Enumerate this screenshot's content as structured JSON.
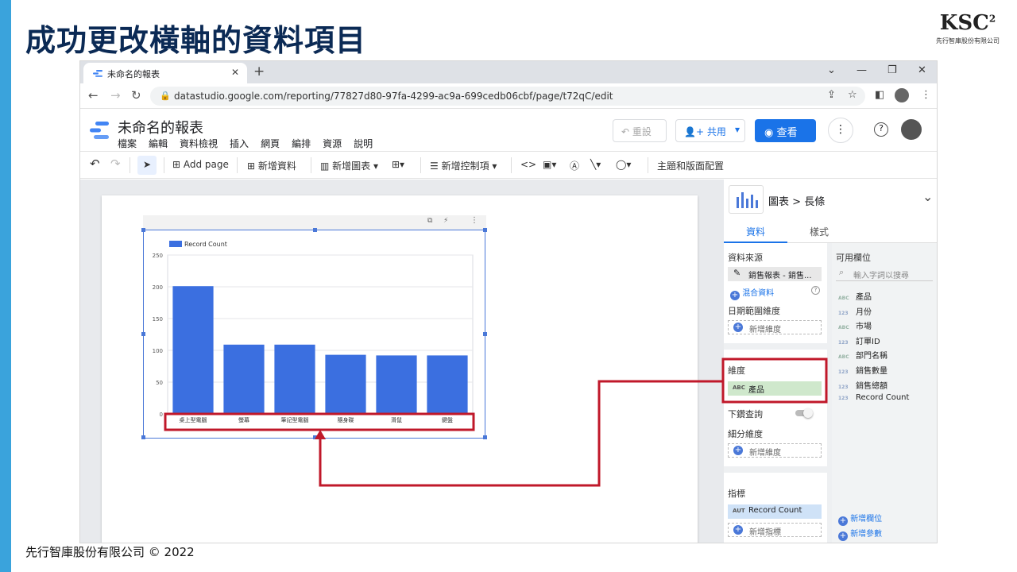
{
  "slide": {
    "title": "成功更改橫軸的資料項目",
    "footer": "先行智庫股份有限公司 © 2022",
    "logo_text": "KSC",
    "logo_sup": "2",
    "logo_sub": "先行智庫股份有限公司",
    "accent_color": "#3aa3dc",
    "highlight_color": "#c0182a"
  },
  "browser": {
    "tab_title": "未命名的報表",
    "url": "datastudio.google.com/reporting/77827d80-97fa-4299-ac9a-699cedb06cbf/page/t72qC/edit"
  },
  "app": {
    "report_name": "未命名的報表",
    "menu": [
      "檔案",
      "編輯",
      "資料檢視",
      "插入",
      "網頁",
      "編排",
      "資源",
      "說明"
    ],
    "reset_label": "重設",
    "share_label": "共用",
    "view_label": "查看"
  },
  "toolbar": {
    "add_page": "Add page",
    "add_data": "新增資料",
    "add_chart": "新增圖表",
    "add_control": "新增控制項",
    "theme_layout": "主題和版面配置"
  },
  "chart_data": {
    "type": "bar",
    "categories": [
      "桌上型電腦",
      "螢幕",
      "筆記型電腦",
      "隨身碟",
      "滑鼠",
      "鍵盤"
    ],
    "series": [
      {
        "name": "Record Count",
        "values": [
          201,
          109,
          109,
          93,
          92,
          92
        ]
      }
    ],
    "yticks": [
      "0",
      "50",
      "100",
      "150",
      "200",
      "250"
    ],
    "ylim": [
      0,
      250
    ],
    "grid": true,
    "legend": "top-left",
    "bar_color": "#3b6fe0"
  },
  "panel": {
    "breadcrumb_chart": "圖表",
    "breadcrumb_type": "長條",
    "tab_data": "資料",
    "tab_style": "樣式",
    "data_source_label": "資料來源",
    "data_source": "銷售報表 - 銷售...",
    "blend_data": "混合資料",
    "date_range_label": "日期範圍維度",
    "add_dimension": "新增維度",
    "dimension_label": "維度",
    "dimension_value": "產品",
    "dimension_type": "ABC",
    "drilldown_label": "下鑽查詢",
    "breakdown_label": "細分維度",
    "metric_label": "指標",
    "metric_value": "Record Count",
    "metric_type": "AUT",
    "add_metric": "新增指標",
    "fields_label": "可用欄位",
    "search_placeholder": "輸入字詞以搜尋",
    "fields": [
      {
        "type": "ABC",
        "name": "產品"
      },
      {
        "type": "123",
        "name": "月份"
      },
      {
        "type": "ABC",
        "name": "市場"
      },
      {
        "type": "123",
        "name": "訂單ID"
      },
      {
        "type": "ABC",
        "name": "部門名稱"
      },
      {
        "type": "123",
        "name": "銷售數量"
      },
      {
        "type": "123",
        "name": "銷售總額"
      },
      {
        "type": "123",
        "name": "Record Count"
      }
    ],
    "add_field": "新增欄位",
    "add_param": "新增參數"
  }
}
